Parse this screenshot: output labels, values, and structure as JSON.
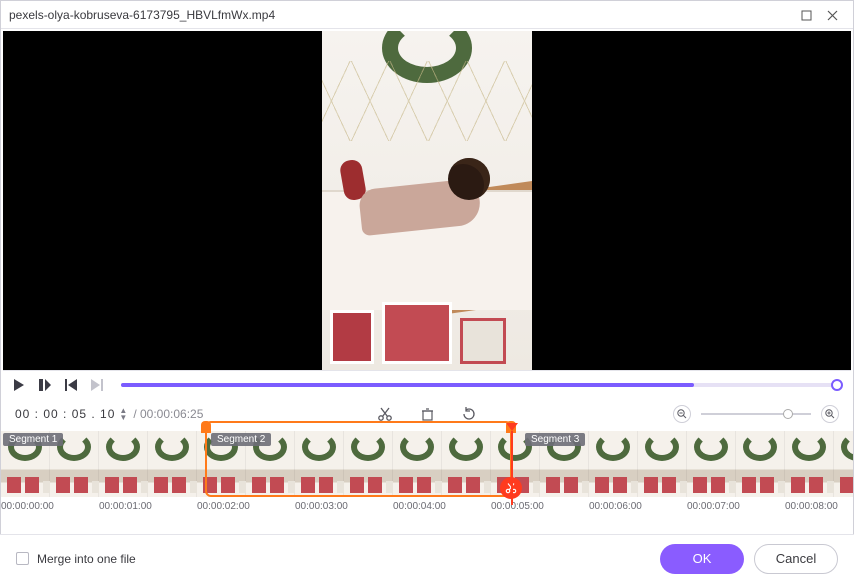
{
  "window": {
    "title": "pexels-olya-kobruseva-6173795_HBVLfmWx.mp4"
  },
  "transport": {
    "play": "▶",
    "stop": "■",
    "prev": "⏮",
    "next": "⏭"
  },
  "time": {
    "current": "00 : 00 : 05 . 10",
    "duration": "/ 00:00:06:25"
  },
  "toolbar": {
    "cut": "✂",
    "delete": "🗑",
    "rotate": "↻",
    "zoom_out": "−",
    "zoom_in": "+"
  },
  "segments": {
    "s1": "Segment 1",
    "s2": "Segment 2",
    "s3": "Segment 3"
  },
  "selection": {
    "start_pct": 24.0,
    "end_pct": 60.0
  },
  "ticks": [
    "00:00:00:00",
    "00:00:01:00",
    "00:00:02:00",
    "00:00:03:00",
    "00:00:04:00",
    "00:00:05:00",
    "00:00:06:00",
    "00:00:07:00",
    "00:00:08:00"
  ],
  "footer": {
    "merge": "Merge into one file",
    "ok": "OK",
    "cancel": "Cancel"
  },
  "colors": {
    "accent": "#8a5cff",
    "cut": "#ff7a1a"
  }
}
